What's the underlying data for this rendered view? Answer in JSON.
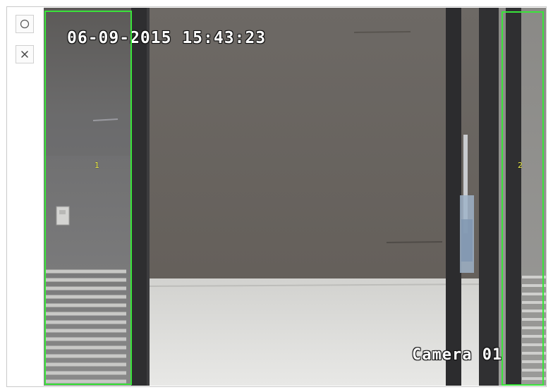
{
  "toolbar": {
    "draw_tool": "circle-icon",
    "clear_tool": "close-icon"
  },
  "video": {
    "osd_datetime": "06-09-2015 15:43:23",
    "osd_camera": "Camera 01"
  },
  "zones": [
    {
      "id": "1",
      "label": "1",
      "color": "#39e43a"
    },
    {
      "id": "2",
      "label": "2",
      "color": "#39e43a"
    }
  ],
  "colors": {
    "zone_outline": "#39e43a",
    "zone_label": "#f2f24a",
    "osd_text": "#ffffff"
  }
}
